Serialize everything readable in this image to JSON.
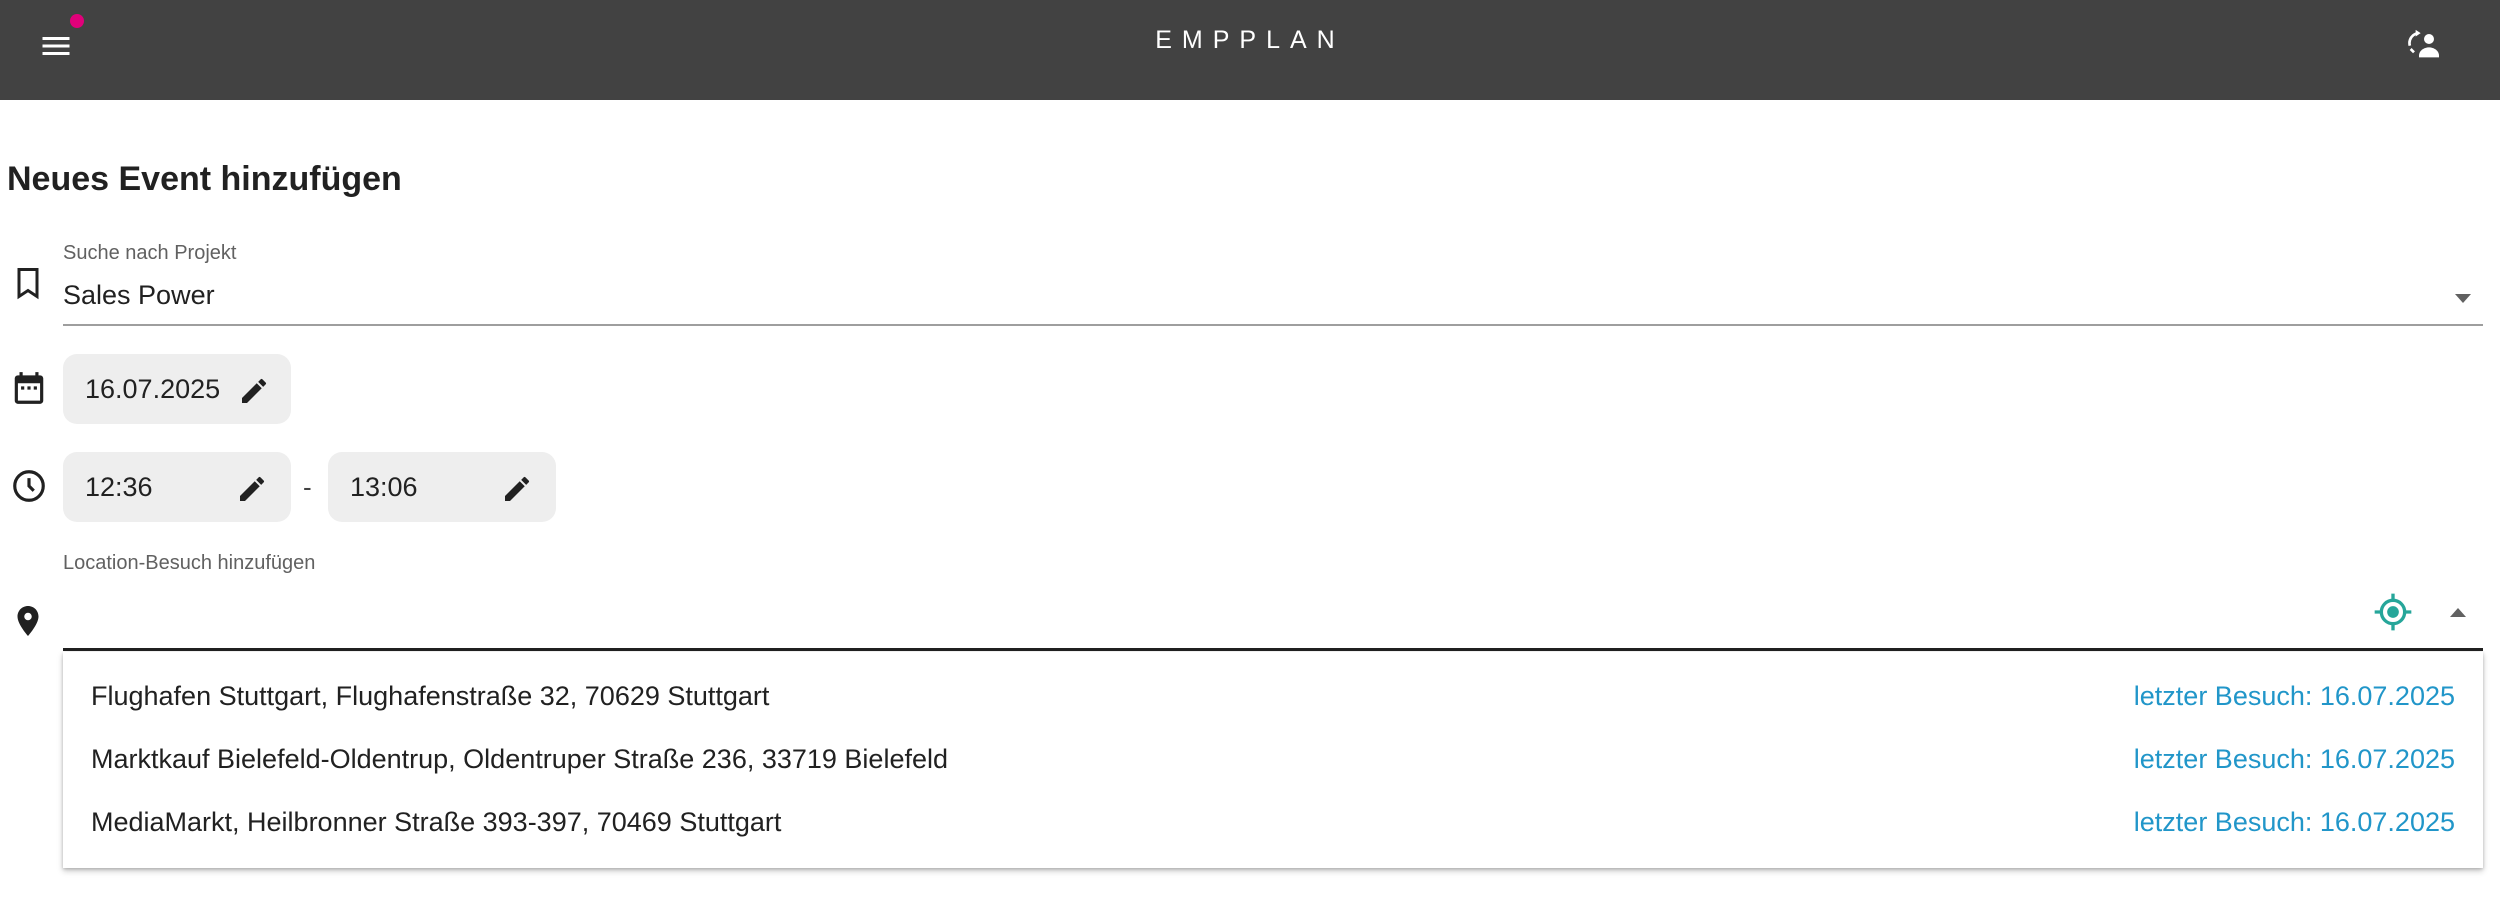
{
  "app": {
    "title": "EMPPLAN"
  },
  "header": {
    "menu_icon": "menu-icon",
    "user_icon": "user-switch-icon",
    "notification_color": "#e0007a"
  },
  "page": {
    "title": "Neues Event hinzufügen"
  },
  "project": {
    "label": "Suche nach Projekt",
    "value": "Sales Power"
  },
  "date": {
    "value": "16.07.2025"
  },
  "time": {
    "start": "12:36",
    "end": "13:06",
    "separator": "-"
  },
  "location": {
    "label": "Location-Besuch hinzufügen",
    "value": "",
    "suggestions": [
      {
        "address": "Flughafen Stuttgart, Flughafenstraße 32, 70629 Stuttgart",
        "last_visit": "letzter Besuch: 16.07.2025"
      },
      {
        "address": "Marktkauf Bielefeld-Oldentrup, Oldentruper Straße 236, 33719 Bielefeld",
        "last_visit": "letzter Besuch: 16.07.2025"
      },
      {
        "address": "MediaMarkt, Heilbronner Straße 393-397, 70469 Stuttgart",
        "last_visit": "letzter Besuch: 16.07.2025"
      }
    ]
  },
  "colors": {
    "appbar": "#424242",
    "accent_teal": "#26a69a",
    "link_blue": "#2196c9"
  }
}
